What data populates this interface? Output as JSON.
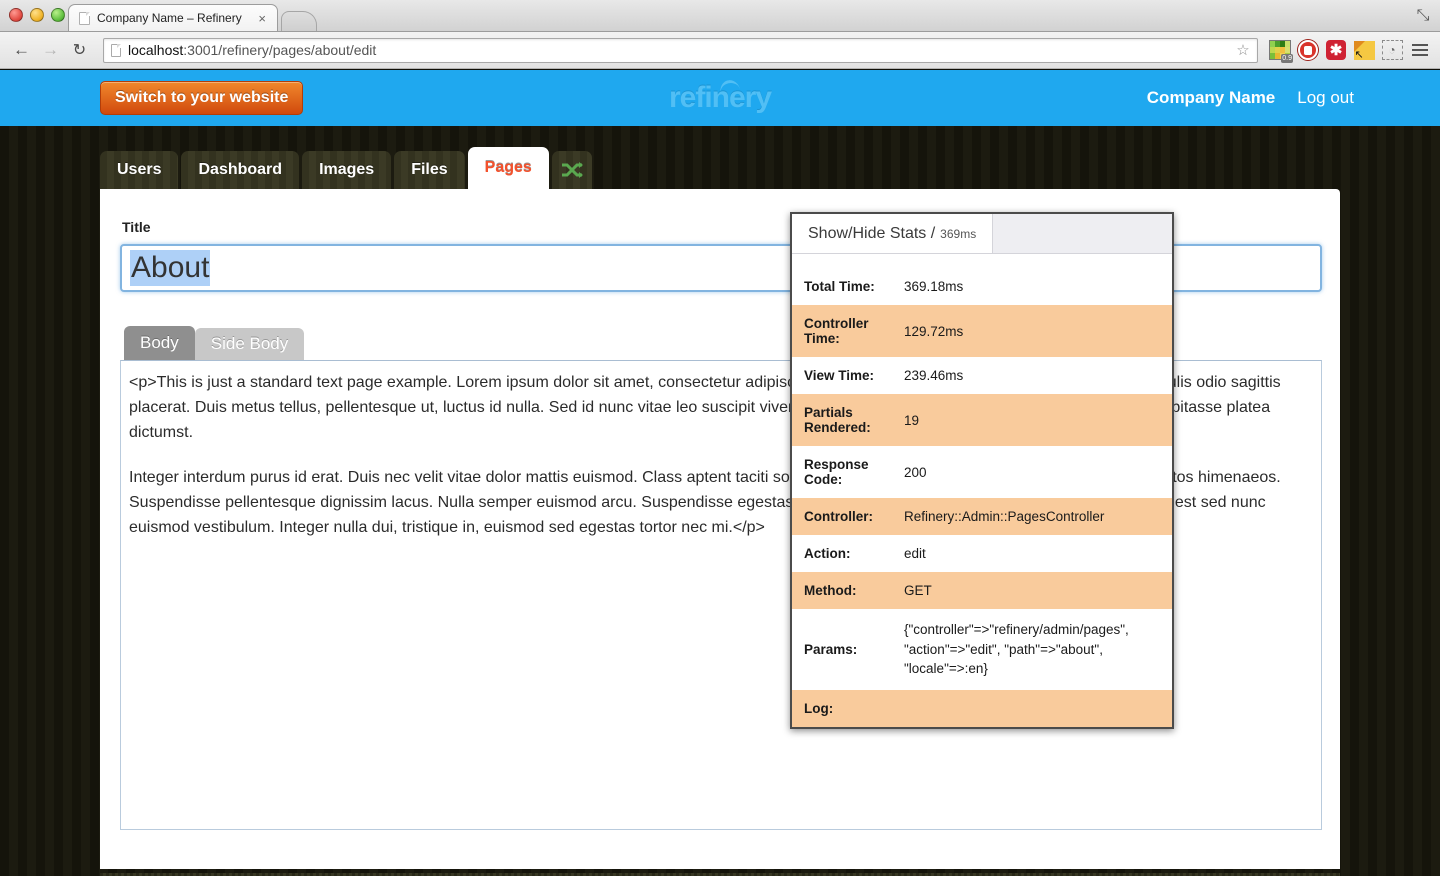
{
  "browser": {
    "tab_title": "Company Name – Refinery",
    "tab_close": "×",
    "url_host": "localhost",
    "url_rest": ":3001/refinery/pages/about/edit",
    "back_glyph": "←",
    "forward_glyph": "→",
    "reload_glyph": "↻",
    "star_glyph": "☆",
    "maximize_glyph": "⤡",
    "color_badge": "0.9",
    "asterisk_glyph": "✱",
    "evernote_glyph": "◔"
  },
  "header": {
    "switch_button": "Switch to your website",
    "logo": "refinery",
    "company": "Company Name",
    "logout": "Log out"
  },
  "tabs": [
    {
      "label": "Users",
      "active": false
    },
    {
      "label": "Dashboard",
      "active": false
    },
    {
      "label": "Images",
      "active": false
    },
    {
      "label": "Files",
      "active": false
    },
    {
      "label": "Pages",
      "active": true
    }
  ],
  "form": {
    "title_label": "Title",
    "title_value": "About",
    "body_tabs": [
      {
        "label": "Body",
        "active": true
      },
      {
        "label": "Side Body",
        "active": false
      }
    ],
    "body_paragraph_1": "<p>This is just a standard text page example. Lorem ipsum dolor sit amet, consectetur adipiscing elit. Nunc, posuere sed, purus. Nullam et velit iaculis odio sagittis placerat. Duis metus tellus, pellentesque ut, luctus id nulla. Sed id nunc vitae leo suscipit viverra. Proin at leo ut lacus consequat rhoncus. In hac habitasse platea dictumst.",
    "body_paragraph_2": "Integer interdum purus id erat. Duis nec velit vitae dolor mattis euismod. Class aptent taciti sociosqu ad litora torquent per conubia nostra, per inceptos himenaeos. Suspendisse pellentesque dignissim lacus. Nulla semper euismod arcu. Suspendisse egestas, nisi vel sollicitudin purus urna et metus. Integer eget est sed nunc euismod vestibulum. Integer nulla dui, tristique in, euismod sed egestas tortor nec mi.</p>"
  },
  "stats": {
    "toggle_label": "Show/Hide Stats /",
    "toggle_ms": "369ms",
    "rows": [
      {
        "key": "Total Time:",
        "value": "369.18ms",
        "shaded": false
      },
      {
        "key": "Controller Time:",
        "value": "129.72ms",
        "shaded": true
      },
      {
        "key": "View Time:",
        "value": "239.46ms",
        "shaded": false
      },
      {
        "key": "Partials Rendered:",
        "value": "19",
        "shaded": true
      },
      {
        "key": "Response Code:",
        "value": "200",
        "shaded": false
      },
      {
        "key": "Controller:",
        "value": "Refinery::Admin::PagesController",
        "shaded": true
      },
      {
        "key": "Action:",
        "value": "edit",
        "shaded": false
      },
      {
        "key": "Method:",
        "value": "GET",
        "shaded": true
      },
      {
        "key": "Params:",
        "value": "{\"controller\"=>\"refinery/admin/pages\",\n\"action\"=>\"edit\", \"path\"=>\"about\",\n\"locale\"=>:en}",
        "shaded": false
      },
      {
        "key": "Log:",
        "value": "",
        "shaded": true
      }
    ]
  },
  "colors": {
    "header_blue": "#1fa8ef",
    "button_orange": "#d1490d",
    "active_tab_text": "#f4512c",
    "stats_shade": "#f9cb9c",
    "focus_blue": "#82b4e0",
    "selection_blue": "#aed0f7"
  }
}
